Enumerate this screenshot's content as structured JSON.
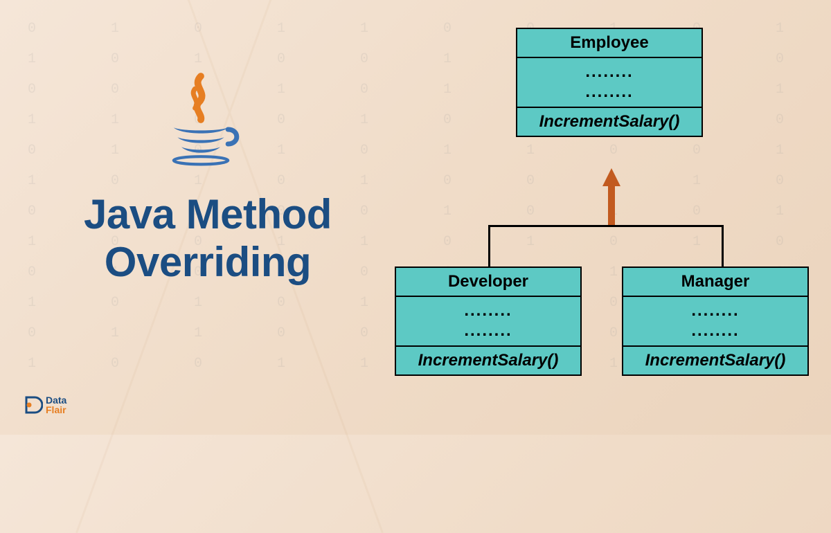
{
  "title_line1": "Java Method",
  "title_line2": "Overriding",
  "brand": {
    "name1": "Data",
    "name2": "Flair"
  },
  "classes": {
    "employee": {
      "name": "Employee",
      "attrs1": "........",
      "attrs2": "........",
      "method": "IncrementSalary()"
    },
    "developer": {
      "name": "Developer",
      "attrs1": "........",
      "attrs2": "........",
      "method": "IncrementSalary()"
    },
    "manager": {
      "name": "Manager",
      "attrs1": "........",
      "attrs2": "........",
      "method": "IncrementSalary()"
    }
  },
  "bg_binary": "0  1  0  1  1  0  0  1  0  1  0\n1  0  1  0  0  1  1  0  1  0  1\n0  0  1  1  0  1  0  1  0  1  0\n1  1  0  0  1  0  1  0  1  0  1\n0  1  0  1  0  1  1  0  0  1  0\n1  0  1  0  1  0  0  1  1  0  1\n0  1  1  0  0  1  0  1  0  1  0\n1  0  0  1  1  0  1  0  1  0  1\n0  1  0  1  0  1  0  1  1  0  0\n1  0  1  0  1  0  1  0  0  1  1\n0  1  1  0  0  1  1  0  1  0  1\n1  0  0  1  1  0  0  1  0  1  0"
}
